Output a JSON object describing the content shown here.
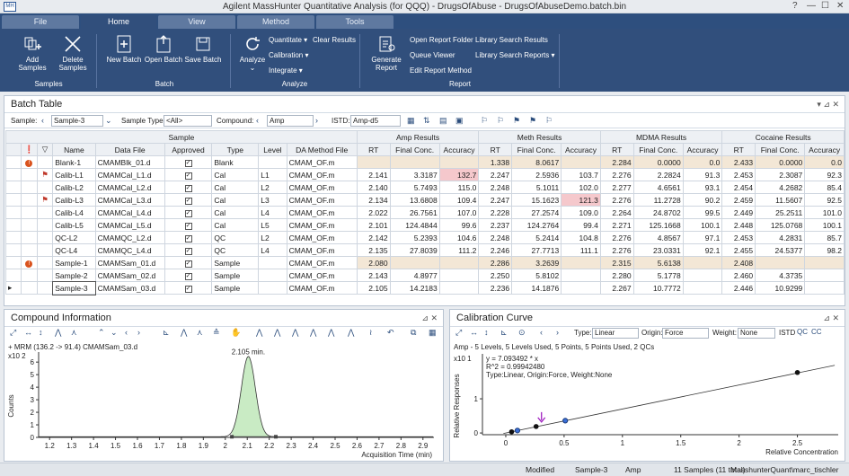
{
  "window": {
    "title": "Agilent MassHunter Quantitative Analysis (for QQQ) - DrugsOfAbuse - DrugsOfAbuseDemo.batch.bin"
  },
  "tabs": [
    "File",
    "Home",
    "View",
    "Method",
    "Tools"
  ],
  "ribbon": {
    "add_samples": "Add Samples",
    "delete_samples": "Delete Samples",
    "samples_group": "Samples",
    "new_batch": "New Batch",
    "open_batch": "Open Batch",
    "save_batch": "Save Batch",
    "batch_group": "Batch",
    "analyze": "Analyze",
    "quantitate": "Quantitate",
    "calibration": "Calibration",
    "integrate": "Integrate",
    "clear_results": "Clear Results",
    "analyze_group": "Analyze",
    "generate_report": "Generate Report",
    "open_report_folder": "Open Report Folder",
    "queue_viewer": "Queue Viewer",
    "edit_report_method": "Edit Report Method",
    "library_search_results": "Library Search Results",
    "library_search_reports": "Library Search Reports",
    "report_group": "Report"
  },
  "batch": {
    "title": "Batch Table",
    "sample_label": "Sample:",
    "sample_value": "Sample-3",
    "sample_type_label": "Sample Type:",
    "sample_type_value": "<All>",
    "compound_label": "Compound:",
    "compound_value": "Amp",
    "istd_label": "ISTD:",
    "istd_value": "Amp-d5",
    "groups": [
      "Sample",
      "Amp Results",
      "Meth Results",
      "MDMA Results",
      "Cocaine Results"
    ],
    "columns": [
      "Name",
      "Data File",
      "Approved",
      "Type",
      "Level",
      "DA Method File"
    ],
    "result_columns": [
      "RT",
      "Final Conc.",
      "Accuracy"
    ],
    "rows": [
      {
        "name": "Blank-1",
        "file": "CMAMBlk_01.d",
        "type": "Blank",
        "level": "",
        "method": "CMAM_OF.m",
        "r": [
          "",
          "",
          "",
          "1.338",
          "8.0617",
          "",
          "2.284",
          "0.0000",
          "0.0",
          "2.433",
          "0.0000",
          "0.0"
        ]
      },
      {
        "name": "Calib-L1",
        "file": "CMAMCal_L1.d",
        "type": "Cal",
        "level": "L1",
        "method": "CMAM_OF.m",
        "r": [
          "2.141",
          "3.3187",
          "132.7",
          "2.247",
          "2.5936",
          "103.7",
          "2.276",
          "2.2824",
          "91.3",
          "2.453",
          "2.3087",
          "92.3"
        ]
      },
      {
        "name": "Calib-L2",
        "file": "CMAMCal_L2.d",
        "type": "Cal",
        "level": "L2",
        "method": "CMAM_OF.m",
        "r": [
          "2.140",
          "5.7493",
          "115.0",
          "2.248",
          "5.1011",
          "102.0",
          "2.277",
          "4.6561",
          "93.1",
          "2.454",
          "4.2682",
          "85.4"
        ]
      },
      {
        "name": "Calib-L3",
        "file": "CMAMCal_L3.d",
        "type": "Cal",
        "level": "L3",
        "method": "CMAM_OF.m",
        "r": [
          "2.134",
          "13.6808",
          "109.4",
          "2.247",
          "15.1623",
          "121.3",
          "2.276",
          "11.2728",
          "90.2",
          "2.459",
          "11.5607",
          "92.5"
        ]
      },
      {
        "name": "Calib-L4",
        "file": "CMAMCal_L4.d",
        "type": "Cal",
        "level": "L4",
        "method": "CMAM_OF.m",
        "r": [
          "2.022",
          "26.7561",
          "107.0",
          "2.228",
          "27.2574",
          "109.0",
          "2.264",
          "24.8702",
          "99.5",
          "2.449",
          "25.2511",
          "101.0"
        ]
      },
      {
        "name": "Calib-L5",
        "file": "CMAMCal_L5.d",
        "type": "Cal",
        "level": "L5",
        "method": "CMAM_OF.m",
        "r": [
          "2.101",
          "124.4844",
          "99.6",
          "2.237",
          "124.2764",
          "99.4",
          "2.271",
          "125.1668",
          "100.1",
          "2.448",
          "125.0768",
          "100.1"
        ]
      },
      {
        "name": "QC-L2",
        "file": "CMAMQC_L2.d",
        "type": "QC",
        "level": "L2",
        "method": "CMAM_OF.m",
        "r": [
          "2.142",
          "5.2393",
          "104.6",
          "2.248",
          "5.2414",
          "104.8",
          "2.276",
          "4.8567",
          "97.1",
          "2.453",
          "4.2831",
          "85.7"
        ]
      },
      {
        "name": "QC-L4",
        "file": "CMAMQC_L4.d",
        "type": "QC",
        "level": "L4",
        "method": "CMAM_OF.m",
        "r": [
          "2.135",
          "27.8039",
          "111.2",
          "2.246",
          "27.7713",
          "111.1",
          "2.276",
          "23.0331",
          "92.1",
          "2.455",
          "24.5377",
          "98.2"
        ]
      },
      {
        "name": "Sample-1",
        "file": "CMAMSam_01.d",
        "type": "Sample",
        "level": "",
        "method": "CMAM_OF.m",
        "r": [
          "2.080",
          "",
          "",
          "2.286",
          "3.2639",
          "",
          "2.315",
          "5.6138",
          "",
          "2.408",
          "",
          ""
        ]
      },
      {
        "name": "Sample-2",
        "file": "CMAMSam_02.d",
        "type": "Sample",
        "level": "",
        "method": "CMAM_OF.m",
        "r": [
          "2.143",
          "4.8977",
          "",
          "2.250",
          "5.8102",
          "",
          "2.280",
          "5.1778",
          "",
          "2.460",
          "4.3735",
          ""
        ]
      },
      {
        "name": "Sample-3",
        "file": "CMAMSam_03.d",
        "type": "Sample",
        "level": "",
        "method": "CMAM_OF.m",
        "r": [
          "2.105",
          "14.2183",
          "",
          "2.236",
          "14.1876",
          "",
          "2.267",
          "10.7772",
          "",
          "2.446",
          "10.9299",
          ""
        ]
      }
    ]
  },
  "compound": {
    "title": "Compound Information",
    "trace": "+ MRM (136.2 -> 91.4) CMAMSam_03.d",
    "yexp": "x10 2",
    "ylabel": "Counts",
    "peak_label": "2.105 min.",
    "xlabel": "Acquisition Time (min)",
    "xticks": [
      "1.2",
      "1.3",
      "1.4",
      "1.5",
      "1.6",
      "1.7",
      "1.8",
      "1.9",
      "2",
      "2.1",
      "2.2",
      "2.3",
      "2.4",
      "2.5",
      "2.6",
      "2.7",
      "2.8",
      "2.9"
    ],
    "yticks": [
      "0",
      "1",
      "2",
      "3",
      "4",
      "5",
      "6"
    ]
  },
  "calib": {
    "title": "Calibration Curve",
    "type_label": "Type:",
    "type_value": "Linear",
    "origin_label": "Origin:",
    "origin_value": "Force",
    "weight_label": "Weight:",
    "weight_value": "None",
    "istd_label": "ISTD",
    "summary": "Amp - 5 Levels, 5 Levels Used, 5 Points, 5 Points Used, 2 QCs",
    "yexp": "x10 1",
    "eq1": "y = 7.093492 * x",
    "eq2": "R^2 = 0.99942480",
    "eq3": "Type:Linear, Origin:Force, Weight:None",
    "ylabel": "Relative Responses",
    "xlabel": "Relative Concentration",
    "xticks": [
      "0",
      "0.5",
      "1",
      "1.5",
      "2",
      "2.5"
    ],
    "yticks": [
      "0",
      "1"
    ]
  },
  "status": {
    "modified": "Modified",
    "sample": "Sample-3",
    "compound": "Amp",
    "count": "11 Samples (11 total)",
    "user": "MasshunterQuant\\marc_tischler"
  },
  "chart_data": [
    {
      "type": "line",
      "title": "+ MRM (136.2 -> 91.4) CMAMSam_03.d",
      "xlabel": "Acquisition Time (min)",
      "ylabel": "Counts",
      "x_range": [
        1.15,
        2.95
      ],
      "ylim": [
        0,
        6.8
      ],
      "peak": {
        "rt": 2.105,
        "height": 6.4,
        "start": 2.03,
        "end": 2.23
      }
    },
    {
      "type": "scatter",
      "title": "Amp - 5 Levels, 5 Levels Used, 5 Points, 5 Points Used, 2 QCs",
      "xlabel": "Relative Concentration",
      "ylabel": "Relative Responses",
      "xlim": [
        -0.2,
        2.85
      ],
      "ylim": [
        -0.05,
        2.0
      ],
      "series": [
        {
          "name": "Calibration",
          "x": [
            0.05,
            0.1,
            0.26,
            2.5
          ],
          "y": [
            0.035,
            0.07,
            0.19,
            1.77
          ]
        },
        {
          "name": "QC",
          "x": [
            0.1,
            0.51
          ],
          "y": [
            0.072,
            0.36
          ]
        }
      ],
      "fit": {
        "slope": 0.7093492,
        "r2": 0.9994248
      }
    }
  ]
}
